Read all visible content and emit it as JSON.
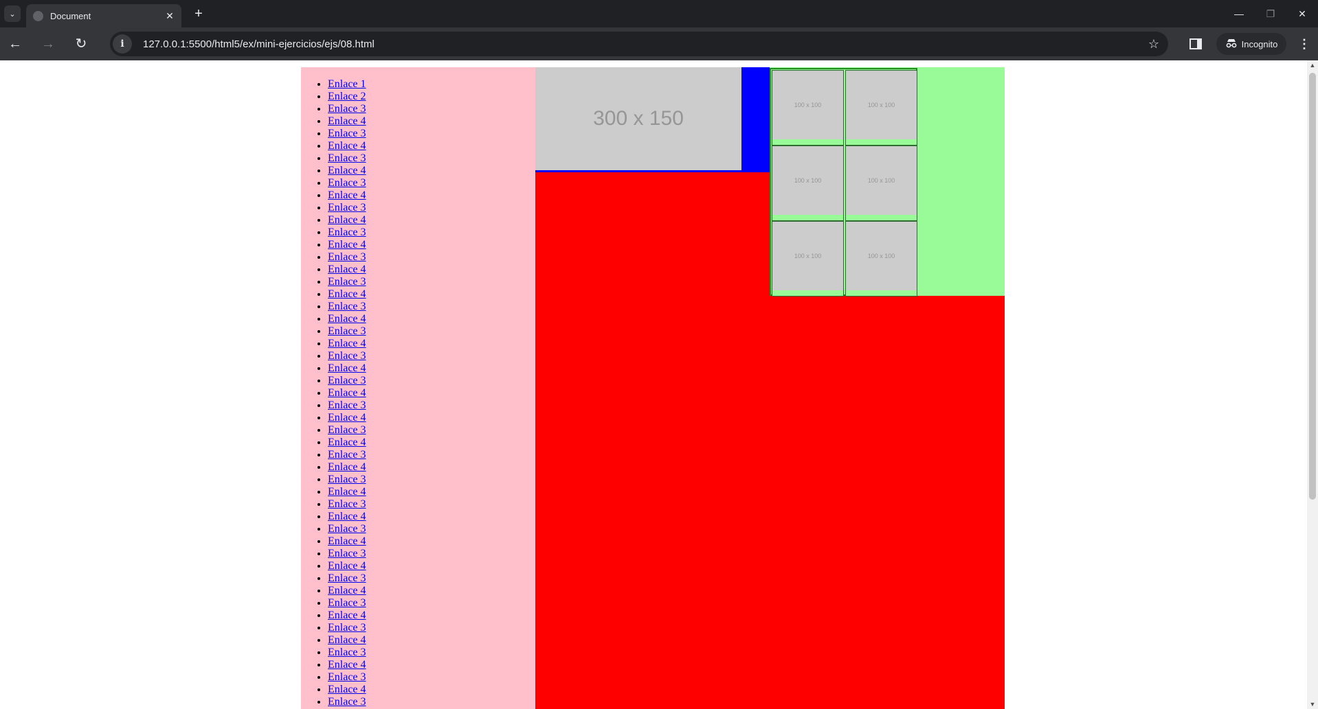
{
  "browser": {
    "tab_title": "Document",
    "tab_close": "✕",
    "new_tab": "+",
    "url": "127.0.0.1:5500/html5/ex/mini-ejercicios/ejs/08.html",
    "incognito_label": "Incognito",
    "icons": {
      "back": "←",
      "forward": "→",
      "reload": "↻",
      "site_info": "i",
      "star": "☆",
      "menu": "⋮",
      "minimize": "—",
      "restore": "❐",
      "close": "✕",
      "tab_search": "⌄"
    }
  },
  "page": {
    "colors": {
      "nav_background": "#ffc0cb",
      "main_background": "#ff0000",
      "hero_background": "#0000ff",
      "gallery_background": "#98fb98",
      "placeholder": "#cccccc",
      "link": "#0000ee"
    },
    "nav_links": [
      "Enlace 1",
      "Enlace 2",
      "Enlace 3",
      "Enlace 4",
      "Enlace 3",
      "Enlace 4",
      "Enlace 3",
      "Enlace 4",
      "Enlace 3",
      "Enlace 4",
      "Enlace 3",
      "Enlace 4",
      "Enlace 3",
      "Enlace 4",
      "Enlace 3",
      "Enlace 4",
      "Enlace 3",
      "Enlace 4",
      "Enlace 3",
      "Enlace 4",
      "Enlace 3",
      "Enlace 4",
      "Enlace 3",
      "Enlace 4",
      "Enlace 3",
      "Enlace 4",
      "Enlace 3",
      "Enlace 4",
      "Enlace 3",
      "Enlace 4",
      "Enlace 3",
      "Enlace 4",
      "Enlace 3",
      "Enlace 4",
      "Enlace 3",
      "Enlace 4",
      "Enlace 3",
      "Enlace 4",
      "Enlace 3",
      "Enlace 4",
      "Enlace 3",
      "Enlace 4",
      "Enlace 3",
      "Enlace 4",
      "Enlace 3",
      "Enlace 4",
      "Enlace 3",
      "Enlace 4",
      "Enlace 3",
      "Enlace 4",
      "Enlace 3"
    ],
    "hero_image_label": "300 x 150",
    "gallery_labels": [
      "100 x 100",
      "100 x 100",
      "100 x 100",
      "100 x 100",
      "100 x 100",
      "100 x 100"
    ]
  }
}
